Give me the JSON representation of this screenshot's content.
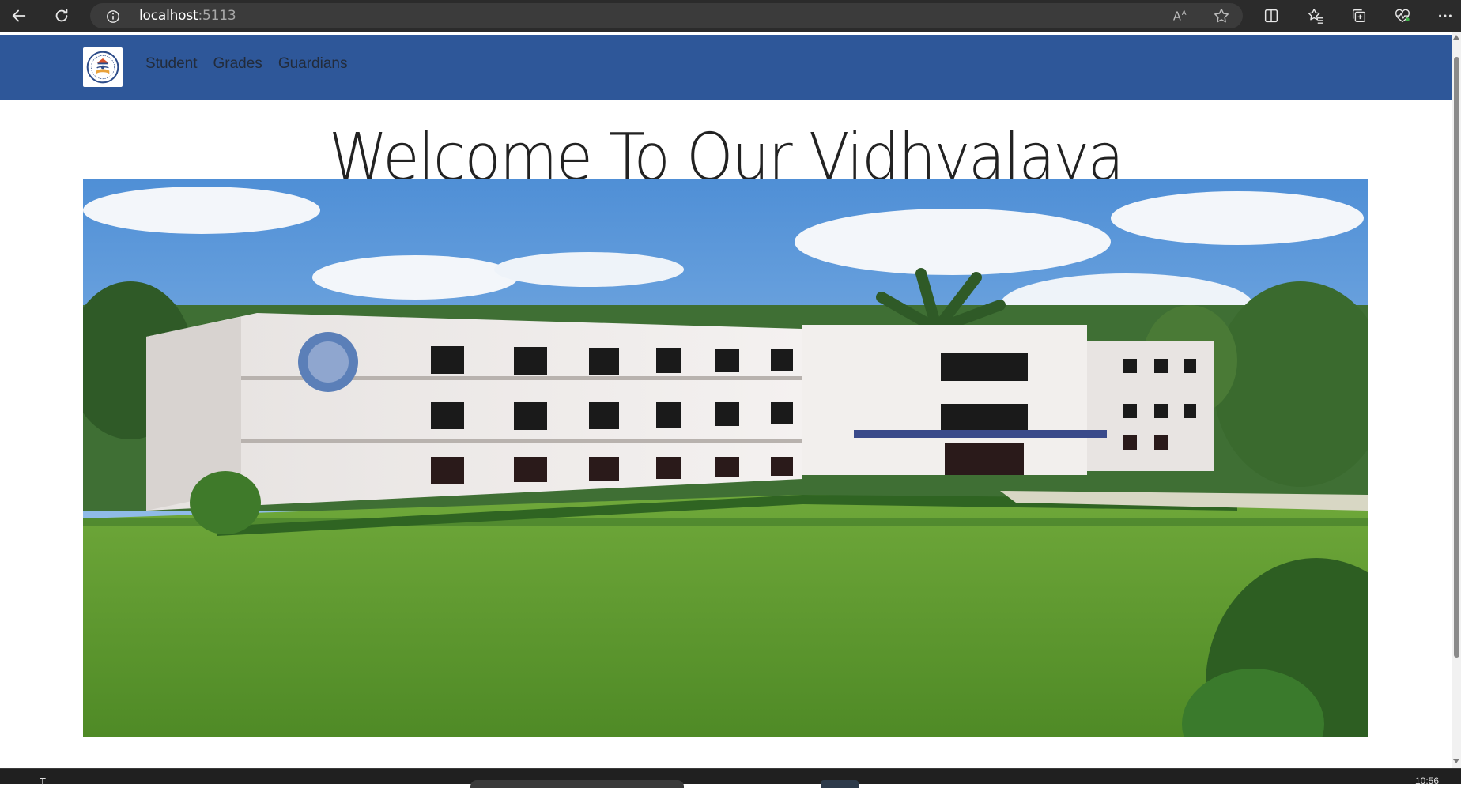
{
  "browser": {
    "url_host": "localhost",
    "url_port": ":5113"
  },
  "nav": {
    "links": [
      "Student",
      "Grades",
      "Guardians"
    ]
  },
  "main": {
    "title": "Welcome To Our Vidhyalaya"
  },
  "taskbar": {
    "left_text": "T",
    "clock": "10:56"
  },
  "colors": {
    "navbar": "#2e5799",
    "browser_chrome": "#2b2b2b",
    "title_text": "#222222"
  }
}
